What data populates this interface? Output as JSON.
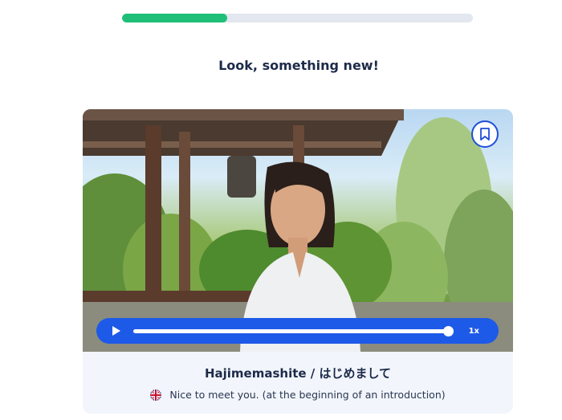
{
  "progress": {
    "value_fraction": 0.3
  },
  "heading": "Look, something new!",
  "lesson": {
    "phrase": "Hajimemashite / はじめまして",
    "translation": "Nice to meet you. (at the beginning of an introduction)",
    "translation_flag_icon": "uk-flag-icon"
  },
  "player": {
    "play_icon": "play-icon",
    "speed_label": "1x",
    "seek_position_fraction": 0.99
  },
  "bookmark": {
    "icon": "bookmark-icon"
  },
  "colors": {
    "progress_fill": "#1fbf7a",
    "progress_track": "#e3e7ef",
    "player_bar": "#1e5ae8",
    "card_bg": "#f2f6fc",
    "text": "#1d2b4a"
  }
}
